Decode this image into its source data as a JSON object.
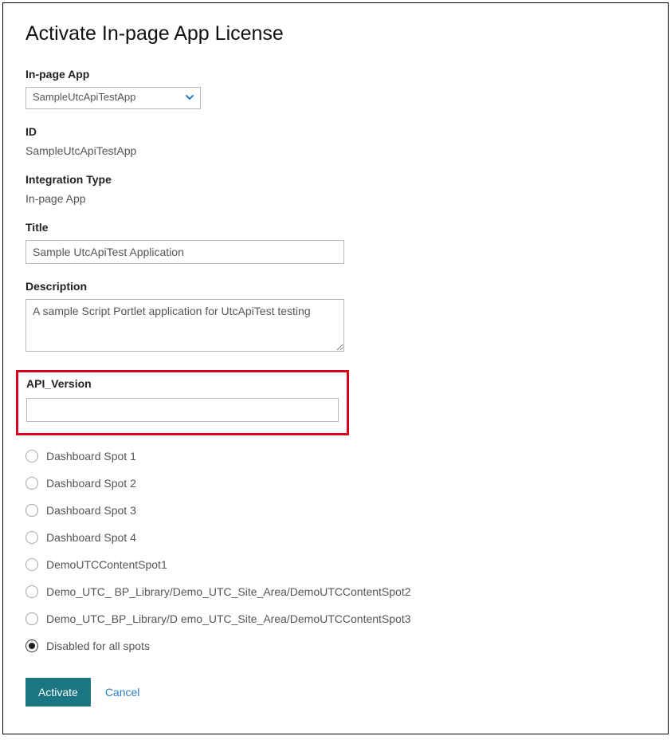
{
  "page_title": "Activate In-page App License",
  "fields": {
    "inpage_app": {
      "label": "In-page App",
      "value": "SampleUtcApiTestApp"
    },
    "id": {
      "label": "ID",
      "value": "SampleUtcApiTestApp"
    },
    "integration_type": {
      "label": "Integration Type",
      "value": "In-page App"
    },
    "title": {
      "label": "Title",
      "value": "Sample UtcApiTest Application"
    },
    "description": {
      "label": "Description",
      "value": "A sample Script Portlet application for UtcApiTest testing"
    },
    "api_version": {
      "label": "API_Version",
      "value": ""
    }
  },
  "spots": {
    "options": [
      {
        "label": "Dashboard Spot 1",
        "selected": false
      },
      {
        "label": "Dashboard Spot 2",
        "selected": false
      },
      {
        "label": "Dashboard Spot 3",
        "selected": false
      },
      {
        "label": "Dashboard Spot 4",
        "selected": false
      },
      {
        "label": "DemoUTCContentSpot1",
        "selected": false
      },
      {
        "label": "Demo_UTC_ BP_Library/Demo_UTC_Site_Area/DemoUTCContentSpot2",
        "selected": false
      },
      {
        "label": "Demo_UTC_BP_Library/D emo_UTC_Site_Area/DemoUTCContentSpot3",
        "selected": false
      },
      {
        "label": "Disabled for all spots",
        "selected": true
      }
    ]
  },
  "buttons": {
    "activate": "Activate",
    "cancel": "Cancel"
  },
  "colors": {
    "primary": "#1b7683",
    "link": "#2a7fc4",
    "highlight": "#d9001b"
  }
}
